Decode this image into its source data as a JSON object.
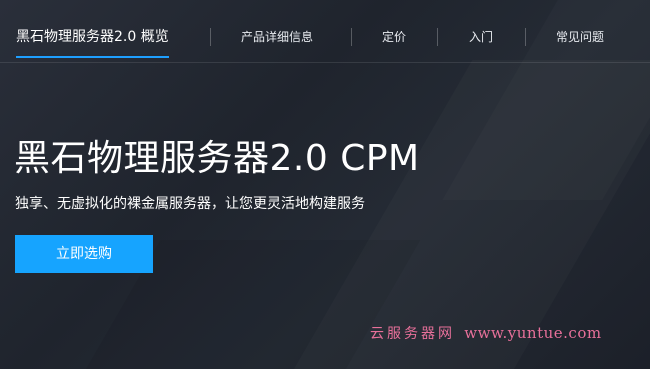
{
  "nav": {
    "items": [
      {
        "label": "黑石物理服务器2.0 概览"
      },
      {
        "label": "产品详细信息"
      },
      {
        "label": "定价"
      },
      {
        "label": "入门"
      },
      {
        "label": "常见问题"
      }
    ]
  },
  "hero": {
    "title": "黑石物理服务器2.0 CPM",
    "subtitle": "独享、无虚拟化的裸金属服务器，让您更灵活地构建服务",
    "cta_label": "立即选购"
  },
  "watermark": {
    "site_name": "云服务器网",
    "url": "www.yuntue.com"
  },
  "colors": {
    "accent": "#16a4ff",
    "active_underline": "#1e9fff",
    "background": "#23282f",
    "watermark": "#e8709a"
  }
}
